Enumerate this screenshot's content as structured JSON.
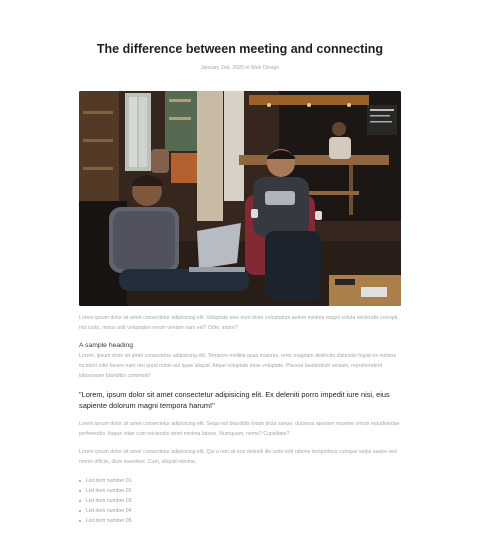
{
  "post": {
    "title": "The difference between meeting and connecting",
    "date": "January 2nd, 2020",
    "in_word": "in",
    "category": "Web Design",
    "hero_image_alt": "Two men laughing while seated in a coffee shop"
  },
  "content": {
    "intro": "Lorem ipsum dolor sit amet consectetur adipisicing elit. Voluptate eius eum dolor voluptatum autem minima magni soluta reiciendis corrupti, nisi iusto, minus odit voluptates rerum veniam nam vel? Odio, totam?",
    "heading": "A sample heading",
    "para2": "Lorem, ipsum dolor sit amet consectetur adipisicing elit. Tempore mollitia quas maiores, error magnam distinctio distinctio fugiat ex minima incidunt odio facere nam nisi quod nobis aut quae aliquid. Atque voluptate esse voluptate. Placeat laudantium veniam, reprehenderit laboriosam blanditiis commodi!",
    "quote": "\"Lorem, ipsum dolor sit amet consectetur adipisicing elit. Ex deleniti porro impedit iure nisi, eius sapiente dolorum magni tempora harum!\"",
    "para3": "Lorem ipsum dolor sit amet consectetur adipisicing elit. Sequi est blanditiis totam dicta saepe, ducimus aperiam maxime omnis repudiandae perferendis. Itaque vitae cum reiciendis amet minima labore. Numquam, nemo? Cupiditate?",
    "para4": "Lorem ipsum dolor sit amet consectetur adipisicing elit. Qui a non sit eos deleniti illo iusto odit ratione temporibus cumque sequi saepe sed omnis officiis, illum inventore. Cum, aliquid minima.",
    "list_items": [
      "List item number 01",
      "List item number 02",
      "List item number 03",
      "List item number 04",
      "List item number 05"
    ]
  }
}
